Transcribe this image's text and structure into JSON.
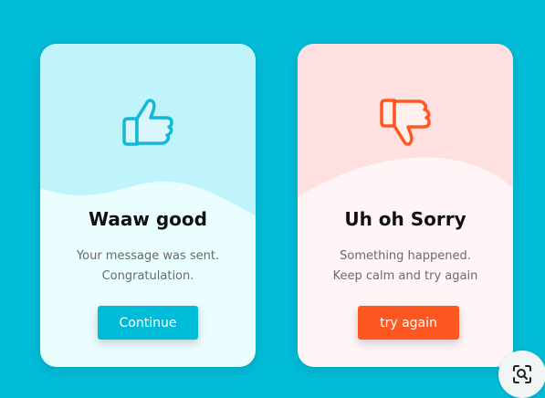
{
  "colors": {
    "page_background": "#00bcd8",
    "success_accent": "#00bcd8",
    "success_wave": "#c0f4fc",
    "error_accent": "#ff5722",
    "error_wave": "#ffe0e0"
  },
  "success_card": {
    "icon": "thumbs-up-icon",
    "title": "Waaw good",
    "message_line1": "Your message was sent.",
    "message_line2": "Congratulation.",
    "button_label": "Continue"
  },
  "error_card": {
    "icon": "thumbs-down-icon",
    "title": "Uh oh Sorry",
    "message_line1": "Something happened.",
    "message_line2": "Keep calm and try again",
    "button_label": "try again"
  },
  "corner_button": {
    "icon": "lens-search-icon"
  }
}
